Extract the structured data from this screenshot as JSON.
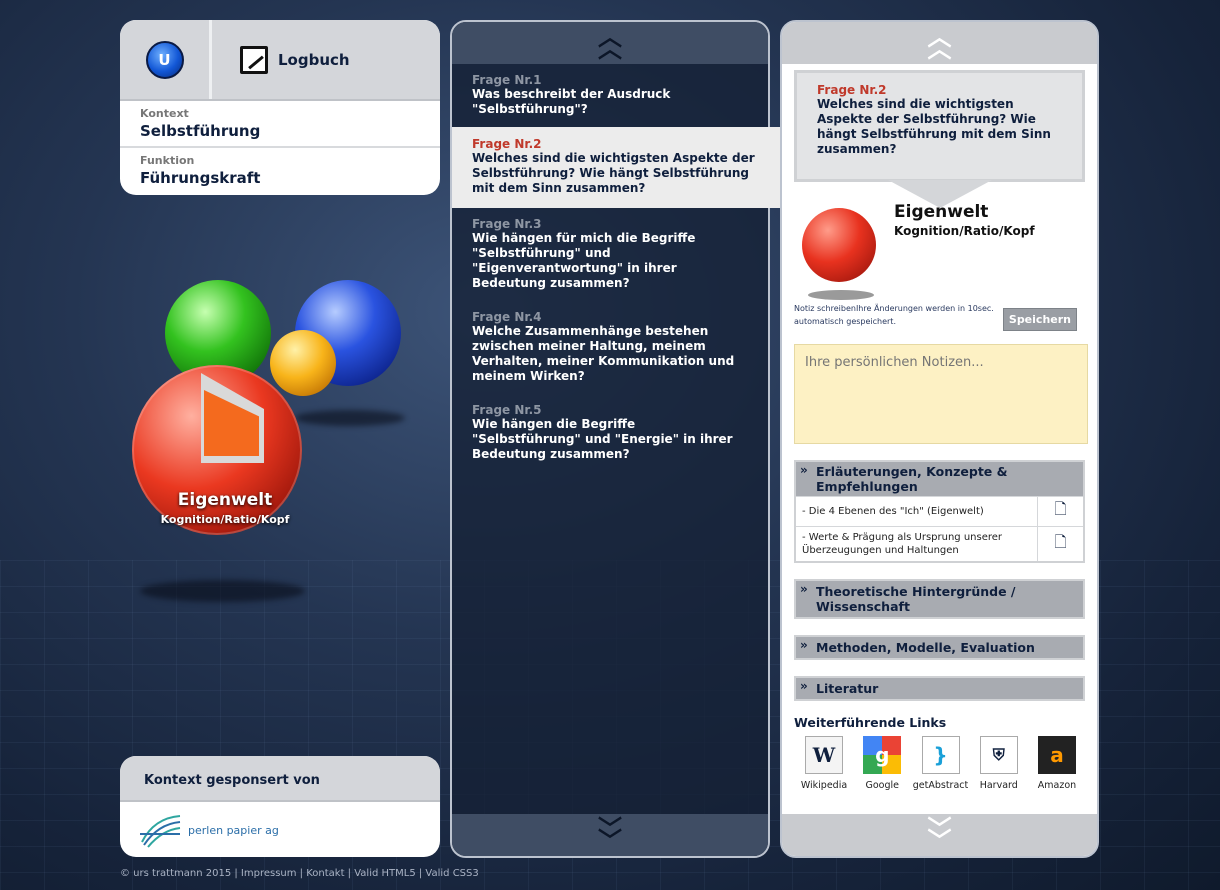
{
  "header": {
    "logbuch_label": "Logbuch"
  },
  "context": {
    "kontext_label": "Kontext",
    "kontext_value": "Selbstführung",
    "funktion_label": "Funktion",
    "funktion_value": "Führungskraft"
  },
  "sphere": {
    "title": "Eigenwelt",
    "subtitle": "Kognition/Ratio/Kopf"
  },
  "sponsor": {
    "heading": "Kontext gesponsert von",
    "name": "perlen papier ag"
  },
  "footer": {
    "text": "© urs trattmann 2015 | Impressum | Kontakt | Valid HTML5 | Valid CSS3"
  },
  "questions": [
    {
      "num": "Frage Nr.1",
      "text": "Was beschreibt der Ausdruck \"Selbstführung\"?"
    },
    {
      "num": "Frage Nr.2",
      "text": "Welches sind die wichtigsten Aspekte der Selbstführung? Wie hängt Selbstführung mit dem Sinn zusammen?"
    },
    {
      "num": "Frage Nr.3",
      "text": "Wie hängen für mich die Begriffe \"Selbstführung\" und \"Eigenverantwortung\" in ihrer Bedeutung zusammen?"
    },
    {
      "num": "Frage Nr.4",
      "text": "Welche Zusammenhänge bestehen zwischen meiner Haltung, meinem Verhalten, meiner Kommunikation und meinem Wirken?"
    },
    {
      "num": "Frage Nr.5",
      "text": "Wie hängen die Begriffe \"Selbstführung\" und \"Energie\" in ihrer Bedeutung zusammen?"
    }
  ],
  "detail": {
    "num": "Frage Nr.2",
    "text": "Welches sind die wichtigsten Aspekte der Selbstführung? Wie hängt Selbstführung mit dem Sinn zusammen?",
    "title": "Eigenwelt",
    "subtitle": "Kognition/Ratio/Kopf",
    "note_info": "Notiz schreibenIhre Änderungen werden in 10sec. automatisch gespeichert.",
    "save_label": "Speichern",
    "notes_placeholder": "Ihre persönlichen Notizen..."
  },
  "accordion": {
    "open_title": "Erläuterungen, Konzepte & Empfehlungen",
    "items": [
      "- Die 4 Ebenen des \"Ich\" (Eigenwelt)",
      "- Werte & Prägung als Ursprung unserer Überzeugungen und Haltungen"
    ],
    "closed": [
      "Theoretische Hintergründe / Wissenschaft",
      "Methoden, Modelle, Evaluation",
      "Literatur"
    ]
  },
  "links": {
    "title": "Weiterführende Links",
    "items": [
      "Wikipedia",
      "Google",
      "getAbstract",
      "Harvard",
      "Amazon"
    ]
  },
  "colors": {
    "accent_red": "#c0392b",
    "navy": "#0f1f3d",
    "notes_bg": "#fdf1c4"
  }
}
